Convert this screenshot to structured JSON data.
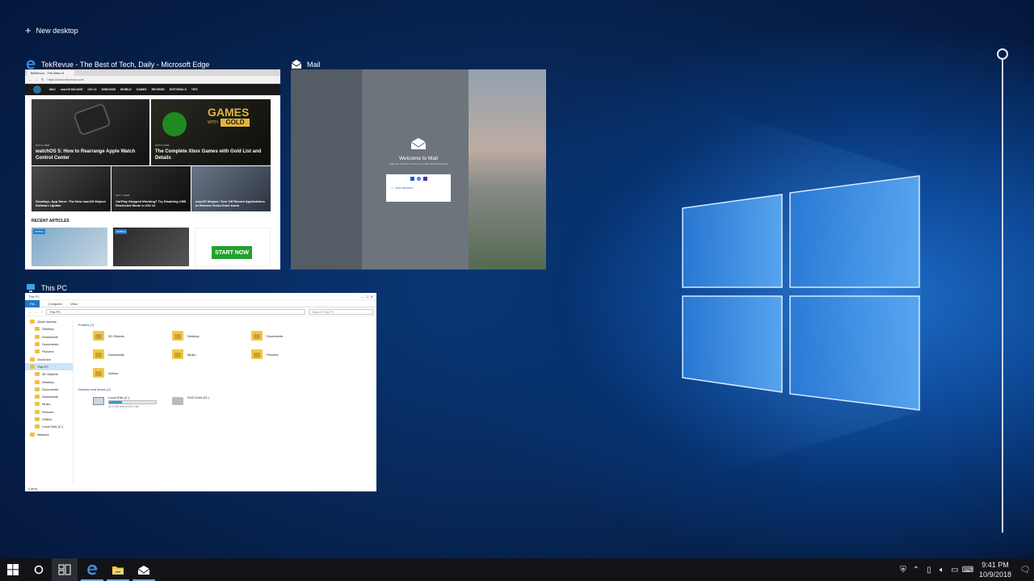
{
  "task_view": {
    "new_desktop_label": "New desktop"
  },
  "windows": {
    "edge": {
      "title": "TekRevue - The Best of Tech, Daily - Microsoft Edge",
      "tab_label": "TekRevue - The Best of",
      "url": "https://www.tekrevue.com",
      "nav_items": [
        "MAC",
        "macOS MOJAVE",
        "iOS 12",
        "WINDOWS",
        "MOBILE",
        "GAMES",
        "REVIEWS",
        "EDITORIALS",
        "TIPS"
      ],
      "featured": [
        {
          "date": "OCT 9, 2018",
          "title": "watchOS 5: How to Rearrange Apple Watch Control Center"
        },
        {
          "date": "OCT 8, 2018",
          "title": "The Complete Xbox Games with Gold List and Details",
          "image_text": "GAMES",
          "image_subtext": "WITH",
          "image_badge": "GOLD"
        },
        {
          "title": "Goodbye, App Store: The New macOS Mojave Software Update"
        },
        {
          "date": "OCT 7, 2018",
          "title": "CarPlay Stopped Working? Try Disabling USB Restricted Mode in iOS 12"
        },
        {
          "title": "macOS Mojave: Turn Off Recent Applications to Remove Extra Dock Icons"
        }
      ],
      "recent_heading": "RECENT ARTICLES",
      "recent_tags": [
        "MOBILE",
        "MOBILE"
      ],
      "ad_button": "START NOW"
    },
    "mail": {
      "title": "Mail",
      "welcome_title": "Welcome to Mail",
      "welcome_sub": "Add your accounts to keep up to date across Windows",
      "add_account": "Add account"
    },
    "explorer": {
      "title": "This PC",
      "ribbon_tabs": [
        "File",
        "Computer",
        "View"
      ],
      "address": "This PC",
      "search_placeholder": "Search This PC",
      "nav": [
        {
          "label": "Quick access",
          "indent": 0
        },
        {
          "label": "Desktop",
          "indent": 1
        },
        {
          "label": "Downloads",
          "indent": 1
        },
        {
          "label": "Documents",
          "indent": 1
        },
        {
          "label": "Pictures",
          "indent": 1
        },
        {
          "label": "OneDrive",
          "indent": 0
        },
        {
          "label": "This PC",
          "indent": 0,
          "selected": true
        },
        {
          "label": "3D Objects",
          "indent": 1
        },
        {
          "label": "Desktop",
          "indent": 1
        },
        {
          "label": "Documents",
          "indent": 1
        },
        {
          "label": "Downloads",
          "indent": 1
        },
        {
          "label": "Music",
          "indent": 1
        },
        {
          "label": "Pictures",
          "indent": 1
        },
        {
          "label": "Videos",
          "indent": 1
        },
        {
          "label": "Local Disk (C:)",
          "indent": 1
        },
        {
          "label": "Network",
          "indent": 0
        }
      ],
      "folders_heading": "Folders (7)",
      "folders": [
        "3D Objects",
        "Desktop",
        "Documents",
        "Downloads",
        "Music",
        "Pictures",
        "Videos"
      ],
      "drives_heading": "Devices and drives (2)",
      "drive_c": {
        "label": "Local Disk (C:)",
        "free": "42.5 GB free of 59.0 GB",
        "used_fraction": 0.28
      },
      "drive_d": {
        "label": "DVD Drive (D:)"
      },
      "status": "8 items"
    }
  },
  "taskbar": {
    "pinned": [
      "start-icon",
      "cortana-icon",
      "task-view-icon",
      "edge-icon",
      "file-explorer-icon",
      "mail-icon"
    ],
    "time": "9:41 PM",
    "date": "10/9/2018"
  },
  "colors": {
    "accent": "#0078d7",
    "desktop": "#0a3a7c",
    "taskbar": "#111317"
  }
}
